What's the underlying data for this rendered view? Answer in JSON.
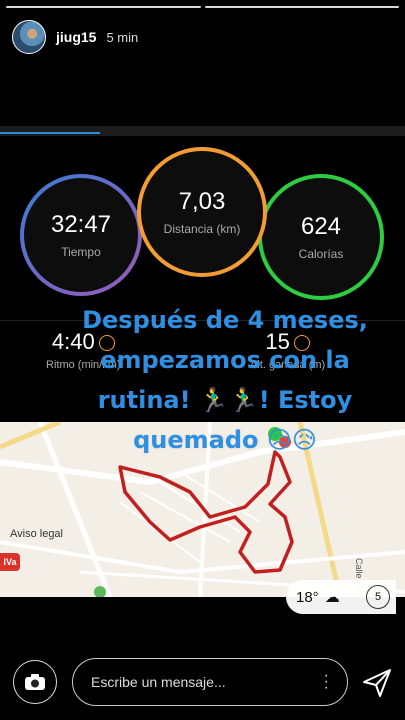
{
  "header": {
    "username": "jiug15",
    "time_ago": "5 min"
  },
  "stats": {
    "time": {
      "value": "32:47",
      "label": "Tiempo"
    },
    "distance": {
      "value": "7,03",
      "label": "Distancia (km)"
    },
    "calories": {
      "value": "624",
      "label": "Calorías"
    },
    "pace": {
      "value": "4:40",
      "label": "Ritmo (min/km)"
    },
    "elevation": {
      "value": "15",
      "label": "Alt. ganada (m)"
    }
  },
  "caption": {
    "text": "Después de 4 meses, empezamos con la rutina! 🏃‍♂️🏃‍♂️! Estoy quemado 😥😥"
  },
  "map": {
    "legal": "Aviso legal",
    "iva": "IVa",
    "street": "Calle Su",
    "temperature": "18°",
    "aqi": "5"
  },
  "compose": {
    "placeholder": "Escribe un mensaje..."
  },
  "colors": {
    "time_ring": "#6b6ad8",
    "distance_ring": "#f39c34",
    "calories_ring": "#2ecc40",
    "caption": "#2f8fe3",
    "route": "#c0201f"
  },
  "icons": {
    "camera": "camera-icon",
    "send": "send-icon",
    "more": "more-dots-icon",
    "weather": "cloud-icon"
  }
}
